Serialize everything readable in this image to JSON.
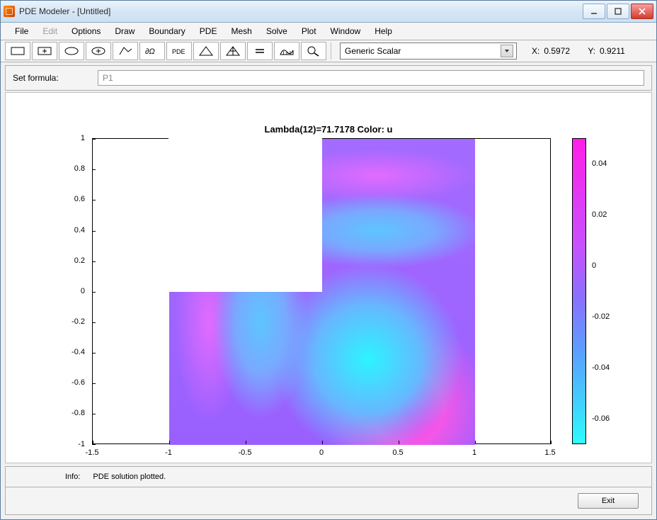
{
  "window": {
    "title": "PDE Modeler - [Untitled]"
  },
  "menu": {
    "items": [
      "File",
      "Edit",
      "Options",
      "Draw",
      "Boundary",
      "PDE",
      "Mesh",
      "Solve",
      "Plot",
      "Window",
      "Help"
    ],
    "disabled": [
      1
    ]
  },
  "toolbar": {
    "dropdown_value": "Generic Scalar",
    "coord_x_label": "X:",
    "coord_x_value": "0.5972",
    "coord_y_label": "Y:",
    "coord_y_value": "0.9211"
  },
  "formula": {
    "label": "Set formula:",
    "value": "P1"
  },
  "info": {
    "label": "Info:",
    "text": "PDE solution plotted."
  },
  "footer": {
    "exit_label": "Exit"
  },
  "chart_data": {
    "type": "heatmap",
    "title": "Lambda(12)=71.7178   Color: u",
    "xlabel": "",
    "ylabel": "",
    "xlim": [
      -1.5,
      1.5
    ],
    "ylim": [
      -1,
      1
    ],
    "xticks": [
      -1.5,
      -1,
      -0.5,
      0,
      0.5,
      1,
      1.5
    ],
    "yticks": [
      -1,
      -0.8,
      -0.6,
      -0.4,
      -0.2,
      0,
      0.2,
      0.4,
      0.6,
      0.8,
      1
    ],
    "domain_polygon": [
      [
        -1,
        -1
      ],
      [
        1,
        -1
      ],
      [
        1,
        1
      ],
      [
        0,
        1
      ],
      [
        0,
        0
      ],
      [
        -1,
        0
      ]
    ],
    "colorbar": {
      "ticks": [
        -0.06,
        -0.04,
        -0.02,
        0,
        0.02,
        0.04
      ],
      "range": [
        -0.07,
        0.05
      ]
    },
    "annotations": [
      {
        "kind": "eigenvalue_index",
        "value": 12
      },
      {
        "kind": "eigenvalue",
        "value": 71.7178
      },
      {
        "kind": "color_quantity",
        "value": "u"
      }
    ],
    "field_extrema_approx": [
      {
        "pos": [
          0.45,
          -0.45
        ],
        "value": -0.065,
        "note": "global min (cyan blob)"
      },
      {
        "pos": [
          0.75,
          -0.85
        ],
        "value": 0.05,
        "note": "local max (magenta blob)"
      },
      {
        "pos": [
          0.5,
          0.35
        ],
        "value": -0.04,
        "note": "upper negative lobe"
      },
      {
        "pos": [
          -0.55,
          -0.45
        ],
        "value": -0.035,
        "note": "left negative lobe"
      },
      {
        "pos": [
          0.5,
          0.85
        ],
        "value": 0.03,
        "note": "top positive band"
      },
      {
        "pos": [
          -0.9,
          -0.5
        ],
        "value": 0.03,
        "note": "far-left positive band"
      }
    ]
  }
}
